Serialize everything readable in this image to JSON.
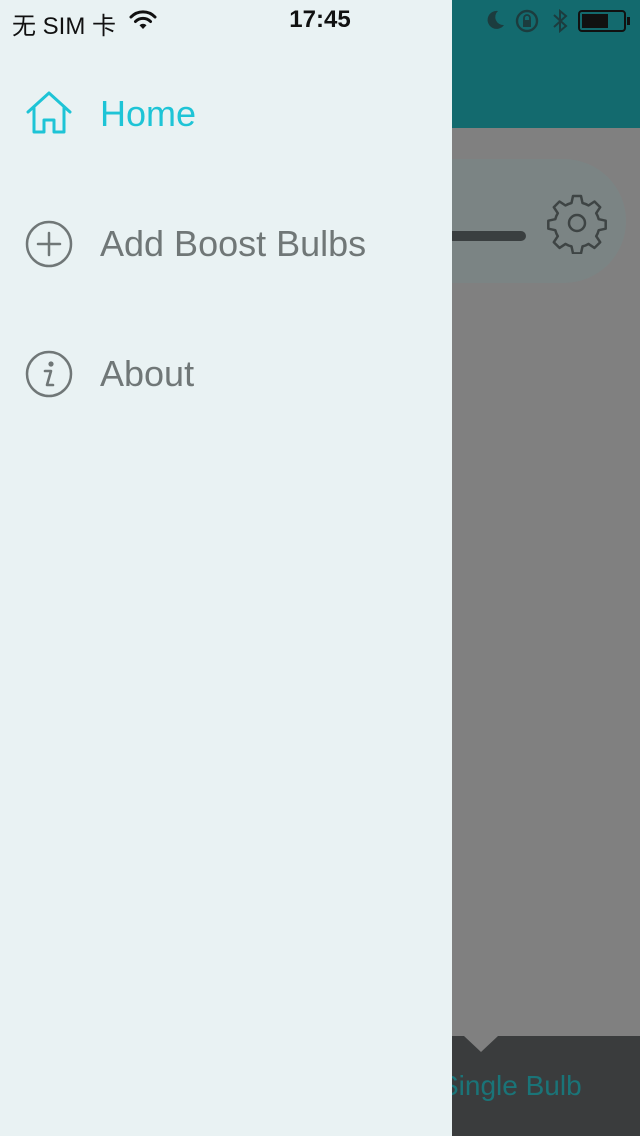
{
  "status_bar": {
    "carrier": "无 SIM 卡",
    "time": "17:45",
    "icons": [
      "wifi-icon",
      "moon-icon",
      "orientation-lock-icon",
      "bluetooth-icon",
      "battery-icon"
    ]
  },
  "drawer": {
    "items": [
      {
        "label": "Home",
        "icon": "home-icon",
        "active": true
      },
      {
        "label": "Add Boost Bulbs",
        "icon": "add-circle-icon",
        "active": false
      },
      {
        "label": "About",
        "icon": "info-icon",
        "active": false
      }
    ]
  },
  "background": {
    "footer_tab_label": "Single Bulb",
    "header_color": "#136a6e"
  },
  "colors": {
    "accent": "#1ec4d6",
    "drawer_bg": "#e9f2f3",
    "inactive_text": "#707777"
  }
}
